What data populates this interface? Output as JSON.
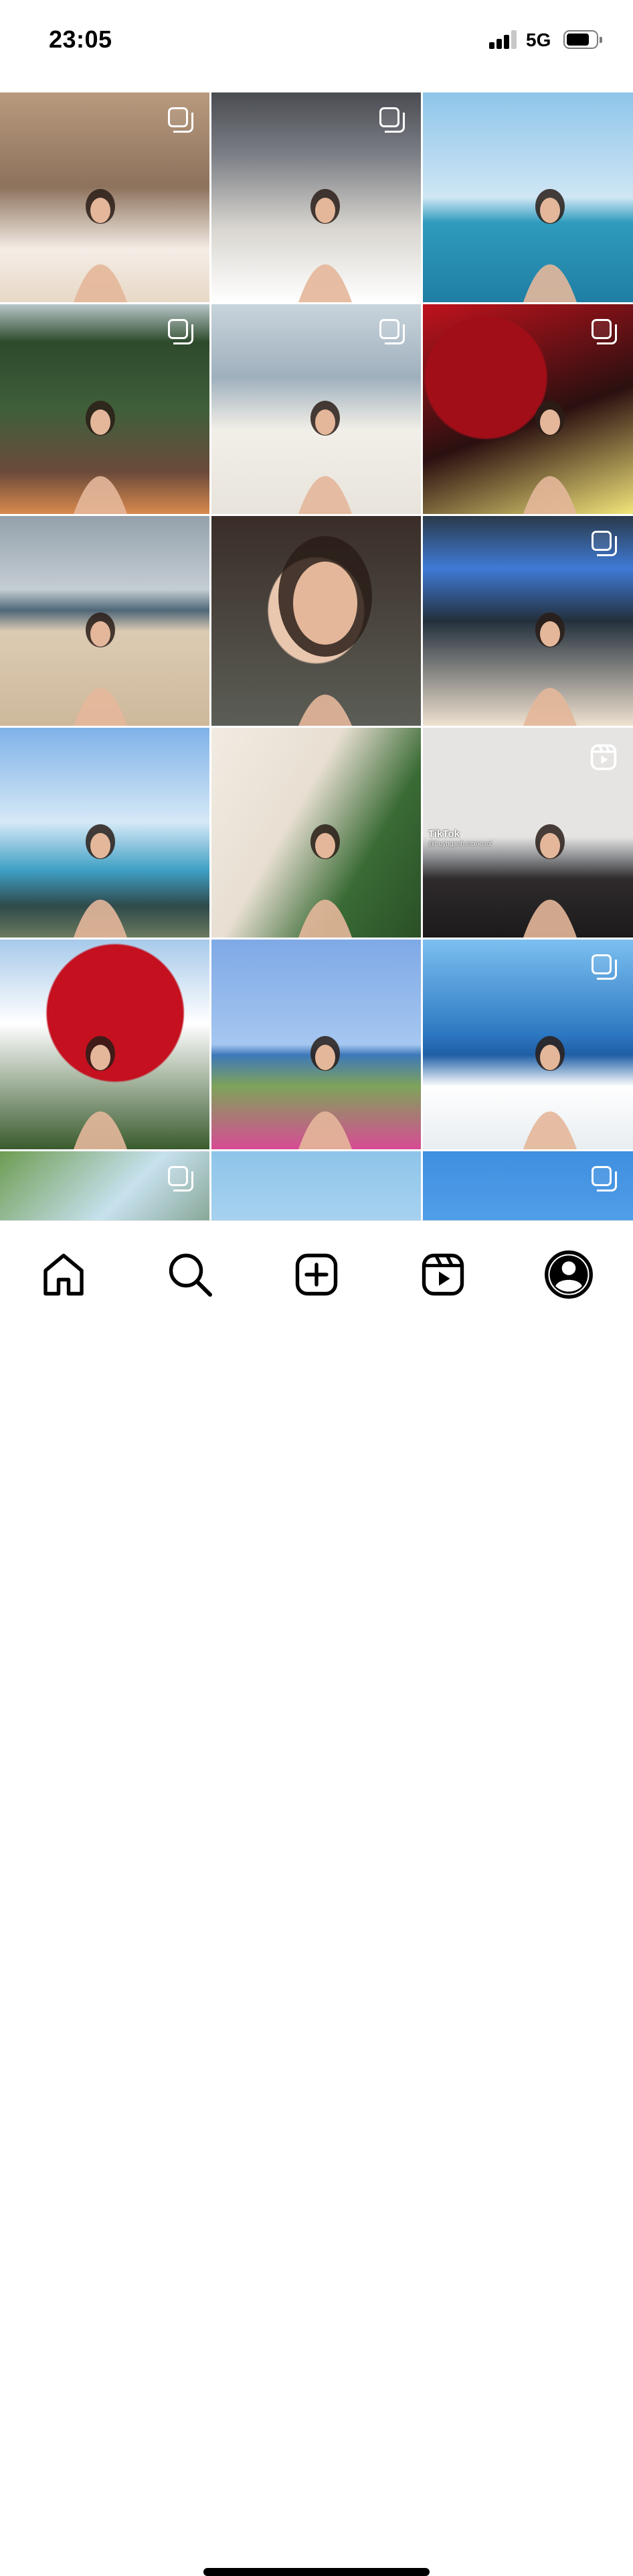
{
  "status_bar": {
    "time": "23:05",
    "network": "5G",
    "signal_bars": 3,
    "battery_level": 0.75
  },
  "grid": {
    "tiles": [
      {
        "kind": "carousel",
        "scene": "indoor-selfie",
        "palette": [
          "#b89a7e",
          "#e8d8c6",
          "#f4ede6"
        ]
      },
      {
        "kind": "carousel",
        "scene": "restaurant-portrait",
        "palette": [
          "#7c7f86",
          "#d9d6d0",
          "#ffffff"
        ]
      },
      {
        "kind": "single",
        "scene": "pool-beach",
        "palette": [
          "#8ec5ea",
          "#2f9bbd",
          "#cfe6f4"
        ]
      },
      {
        "kind": "carousel",
        "scene": "garden-wall",
        "palette": [
          "#2d4a2b",
          "#6b4a3a",
          "#b8c7c9"
        ]
      },
      {
        "kind": "carousel",
        "scene": "dressing-room",
        "palette": [
          "#c9d4dc",
          "#f2efe8",
          "#e8e4dc"
        ]
      },
      {
        "kind": "carousel",
        "scene": "red-roses",
        "palette": [
          "#a10e18",
          "#2a1010",
          "#f1e57a"
        ]
      },
      {
        "kind": "single",
        "scene": "sandy-beach",
        "palette": [
          "#94a1ab",
          "#dccbb3",
          "#4f6777"
        ]
      },
      {
        "kind": "single",
        "scene": "close-portrait",
        "palette": [
          "#3a2d28",
          "#e9c7ae",
          "#5b5e56"
        ]
      },
      {
        "kind": "carousel",
        "scene": "fur-coat",
        "palette": [
          "#2a3a4a",
          "#3f7ad6",
          "#efe1cf"
        ]
      },
      {
        "kind": "single",
        "scene": "rocky-coast",
        "palette": [
          "#7fb2e8",
          "#3e9fc4",
          "#e9a27e"
        ]
      },
      {
        "kind": "single",
        "scene": "sunhat-flowers",
        "palette": [
          "#f1ebe2",
          "#3a6b35",
          "#ffffff"
        ]
      },
      {
        "kind": "reel",
        "scene": "conference-hall",
        "palette": [
          "#e5e4e2",
          "#2f2b2c",
          "#8a8c90"
        ],
        "overlay_brand": "TikTok",
        "overlay_user": "@huynganh.manosol"
      },
      {
        "kind": "single",
        "scene": "bougainvillea",
        "palette": [
          "#c4101f",
          "#ffffff",
          "#3a5b2d"
        ]
      },
      {
        "kind": "single",
        "scene": "flowers-sea",
        "palette": [
          "#7fa9e6",
          "#d84b94",
          "#d9ee3a"
        ]
      },
      {
        "kind": "carousel",
        "scene": "beach-terrace",
        "palette": [
          "#2d78c2",
          "#ffffff",
          "#c8a37a"
        ]
      },
      {
        "kind": "carousel",
        "scene": "palm-leaves",
        "palette": [
          "#6e9c52",
          "#c7e1ee",
          "#3a5f2c"
        ]
      },
      {
        "kind": "single",
        "scene": "sky-tower",
        "palette": [
          "#8ec4ea",
          "#d8eef9",
          "#6b5446"
        ]
      },
      {
        "kind": "carousel",
        "scene": "blue-sky",
        "palette": [
          "#3f8fe0",
          "#5aa5ec",
          "#7fbaf0"
        ]
      }
    ]
  },
  "tab_bar": {
    "items": [
      {
        "name": "home",
        "icon": "home-icon"
      },
      {
        "name": "search",
        "icon": "search-icon"
      },
      {
        "name": "create",
        "icon": "plus-square-icon"
      },
      {
        "name": "reels",
        "icon": "reels-icon"
      },
      {
        "name": "profile",
        "icon": "profile-icon"
      }
    ]
  }
}
